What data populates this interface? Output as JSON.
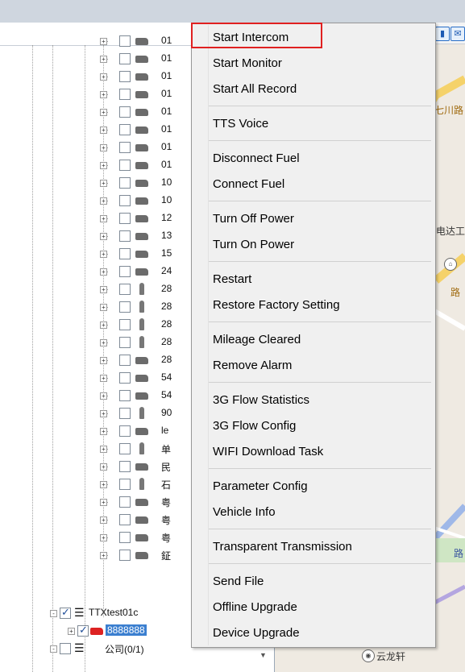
{
  "tree": {
    "vehicles": [
      {
        "icon": "car",
        "label": "01"
      },
      {
        "icon": "car",
        "label": "01"
      },
      {
        "icon": "car",
        "label": "01"
      },
      {
        "icon": "car",
        "label": "01"
      },
      {
        "icon": "car",
        "label": "01"
      },
      {
        "icon": "car",
        "label": "01"
      },
      {
        "icon": "car",
        "label": "01"
      },
      {
        "icon": "car",
        "label": "01"
      },
      {
        "icon": "car",
        "label": "10"
      },
      {
        "icon": "car",
        "label": "10"
      },
      {
        "icon": "car",
        "label": "12"
      },
      {
        "icon": "car",
        "label": "13"
      },
      {
        "icon": "car",
        "label": "15"
      },
      {
        "icon": "car",
        "label": "24"
      },
      {
        "icon": "person",
        "label": "28"
      },
      {
        "icon": "person",
        "label": "28"
      },
      {
        "icon": "person",
        "label": "28"
      },
      {
        "icon": "person",
        "label": "28"
      },
      {
        "icon": "car",
        "label": "28"
      },
      {
        "icon": "car",
        "label": "54"
      },
      {
        "icon": "car",
        "label": "54"
      },
      {
        "icon": "person",
        "label": "90"
      },
      {
        "icon": "car",
        "label": "le"
      },
      {
        "icon": "person",
        "label": "单"
      },
      {
        "icon": "car",
        "label": "民"
      },
      {
        "icon": "person",
        "label": "石"
      },
      {
        "icon": "car",
        "label": "粤"
      },
      {
        "icon": "car",
        "label": "粤"
      },
      {
        "icon": "car",
        "label": "粤"
      },
      {
        "icon": "car",
        "label": "鉦"
      }
    ],
    "group_label": "TTXtest01c",
    "selected_device": "8888888",
    "next_group": "公司(0/1)"
  },
  "map": {
    "labels": {
      "a": "七川路",
      "b": "电达工",
      "c": "路",
      "d": "云龙轩",
      "e": "路"
    }
  },
  "context_menu": {
    "groups": [
      [
        "Start Intercom",
        "Start Monitor",
        "Start All Record"
      ],
      [
        "TTS Voice"
      ],
      [
        "Disconnect Fuel",
        "Connect Fuel"
      ],
      [
        "Turn Off Power",
        "Turn On Power"
      ],
      [
        "Restart",
        "Restore Factory Setting"
      ],
      [
        "Mileage Cleared",
        "Remove Alarm"
      ],
      [
        "3G Flow Statistics",
        "3G Flow Config",
        "WIFI Download Task"
      ],
      [
        "Parameter Config",
        "Vehicle Info"
      ],
      [
        "Transparent Transmission"
      ],
      [
        "Send File",
        "Offline Upgrade",
        "Device Upgrade"
      ]
    ],
    "highlighted_item": "Start Intercom",
    "highlight_color": "#e02020"
  },
  "colors": {
    "selection": "#3b7fd0",
    "accent": "#2a6fc7"
  }
}
